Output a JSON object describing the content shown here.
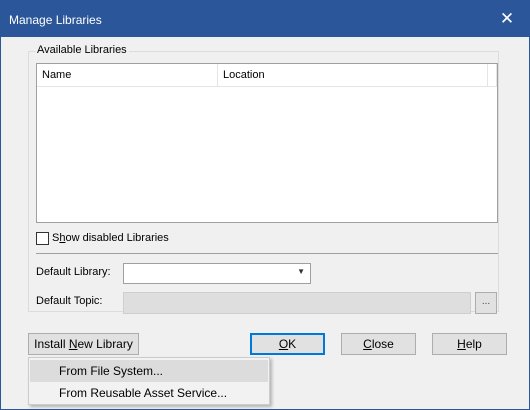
{
  "window": {
    "title": "Manage Libraries",
    "close_glyph": "✕",
    "close_icon": "close-icon"
  },
  "available_libraries": {
    "group_title": "Available Libraries",
    "columns": [
      "Name",
      "Location"
    ],
    "rows": []
  },
  "show_disabled": {
    "label_before": "S",
    "label_mnemonic": "h",
    "label_after": "ow disabled Libraries",
    "checked": false
  },
  "default_library": {
    "label": "Default Library:",
    "value": "",
    "arrow_glyph": "▼",
    "arrow_icon": "chevron-down-icon"
  },
  "default_topic": {
    "label": "Default Topic:",
    "value": "",
    "browse_label": "..."
  },
  "buttons": {
    "install": {
      "before": "Install ",
      "mnemonic": "N",
      "after": "ew Library"
    },
    "ok": {
      "before": "",
      "mnemonic": "O",
      "after": "K"
    },
    "close": {
      "before": "",
      "mnemonic": "C",
      "after": "lose"
    },
    "help": {
      "before": "",
      "mnemonic": "H",
      "after": "elp"
    }
  },
  "install_menu": {
    "items": [
      {
        "label": "From File System...",
        "highlighted": true
      },
      {
        "label": "From Reusable Asset Service...",
        "highlighted": false
      }
    ]
  },
  "colors": {
    "titlebar": "#2b579a",
    "dialog_bg": "#f0f0f0",
    "default_button_border": "#0078d7"
  }
}
